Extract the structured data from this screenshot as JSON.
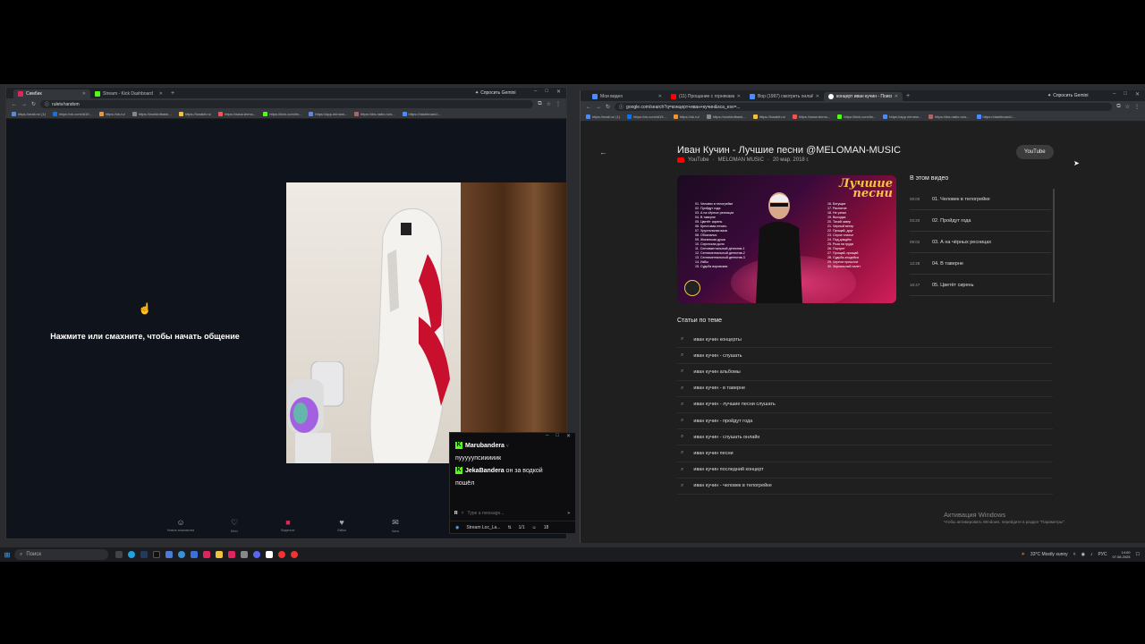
{
  "left_browser": {
    "tabs": [
      {
        "label": "Симбик",
        "color": "#e0245e"
      },
      {
        "label": "Stream - Kick Dashboard",
        "color": "#53fc18"
      }
    ],
    "gemini_label": "Спросить Gemini",
    "url": "ruletv/random",
    "bookmarks": [
      "https://mail.ru/ (1)",
      "https://vk.com/id19...",
      "https://ok.ru/",
      "https://worldofbank...",
      "https://lunakit.ru/",
      "https://www.termo...",
      "https://kick.com/lin...",
      "https://app.mirnew...",
      "https://dw-radio.ru/s...",
      "https://dashboard.l..."
    ],
    "prompt": "Нажмите или смахните, чтобы начать общение",
    "bottom_nav": [
      "Новые знакомства",
      "Мэтч",
      "Видеочат",
      "Лайки",
      "Чаты"
    ]
  },
  "chat": {
    "messages": [
      {
        "user": "Marubandera",
        "text": ""
      },
      {
        "user": "",
        "text": "пууууупсииииик"
      },
      {
        "user": "JekaBandera",
        "text": "он за водкой"
      },
      {
        "user": "",
        "text": "пошёл"
      }
    ],
    "input_placeholder": "Type a message...",
    "footer_label": "Stream Loc_La...",
    "footer_count": "1/1",
    "footer_num": "18"
  },
  "right_browser": {
    "tabs": [
      {
        "label": "Мои видео",
        "color": "#4a8cff"
      },
      {
        "label": "(11) Прощание с горняками - ...",
        "color": "#f00"
      },
      {
        "label": "Вор (1997) смотреть онлайн ...",
        "color": "#4a8cff"
      },
      {
        "label": "концерт иван кучин - Поиск в...",
        "color": "#ffffff"
      }
    ],
    "gemini_label": "Спросить Gemini",
    "url": "google.com/search?q=концерт+иван+кучин&sca_esv=...",
    "bookmarks": [
      "https://mail.ru/ (1)",
      "https://vk.com/id19...",
      "https://ok.ru/",
      "https://worldofbank...",
      "https://lunakit.ru/",
      "https://www.termo...",
      "https://kick.com/lin...",
      "https://app.mirnew...",
      "https://dw-radio.ru/s...",
      "https://dashboard.l..."
    ],
    "video_title": "Иван Кучин - Лучшие песни @MELOMAN-MUSIC",
    "source": "YouTube",
    "channel": "MELOMAN MUSIC",
    "date": "20 мар. 2018 г.",
    "chip": "YouTube",
    "thumb_brand_top": "Лучшие",
    "thumb_brand_bottom": "песни",
    "thumb_songs_left": [
      "01. Человек в телогрейке",
      "02. Пройдут года",
      "03. А на чёрных ресницах",
      "04. В таверне",
      "05. Цветёт сирень",
      "06. Крестовая печать",
      "07. Хрустальная ваза",
      "08. Обознался",
      "09. Жиганская душа",
      "10. Сиротская доля",
      "11. Сентиментальный детектив-1",
      "12. Сентиментальный детектив-2",
      "13. Сентиментальный детектив-3",
      "14. Избы",
      "15. Судьба воровская"
    ],
    "thumb_songs_right": [
      "16. Бегущие",
      "17. Распятие",
      "18. Не узнал",
      "19. Выходка",
      "20. Тихий сквер",
      "21. Черный ветер",
      "22. Прощай, друг",
      "23. Серое платье",
      "24. Под дождём",
      "25. Роза на груди",
      "26. Портрет",
      "27. Прощай, прощай",
      "28. Судьба-злодейка",
      "29. Черное прошлое",
      "30. Зеркальный налет"
    ],
    "chapters_title": "В этом видео",
    "chapters": [
      {
        "time": "00:00",
        "title": "01. Человек в телогрейке"
      },
      {
        "time": "03:20",
        "title": "02. Пройдут года"
      },
      {
        "time": "09:02",
        "title": "03. А на чёрных ресницах"
      },
      {
        "time": "12:28",
        "title": "04. В таверне"
      },
      {
        "time": "16:47",
        "title": "05. Цветёт сирень"
      }
    ],
    "related_title": "Статьи по теме",
    "related": [
      "иван кучин концерты",
      "иван кучин - слушать",
      "иван кучин альбомы",
      "иван кучин - в таверне",
      "иван кучин - лучшие песни слушать",
      "иван кучин - пройдут года",
      "иван кучин - слушать онлайн",
      "иван кучин песни",
      "иван кучин последний концерт",
      "иван кучин - человек в телогрейке"
    ],
    "activation_title": "Активация Windows",
    "activation_sub": "Чтобы активировать Windows, перейдите в раздел \"Параметры\"."
  },
  "taskbar": {
    "search_placeholder": "Поиск",
    "weather": "33°C  Mostly sunny",
    "lang": "РУС",
    "time": "14:00",
    "date": "07.08.2025"
  }
}
